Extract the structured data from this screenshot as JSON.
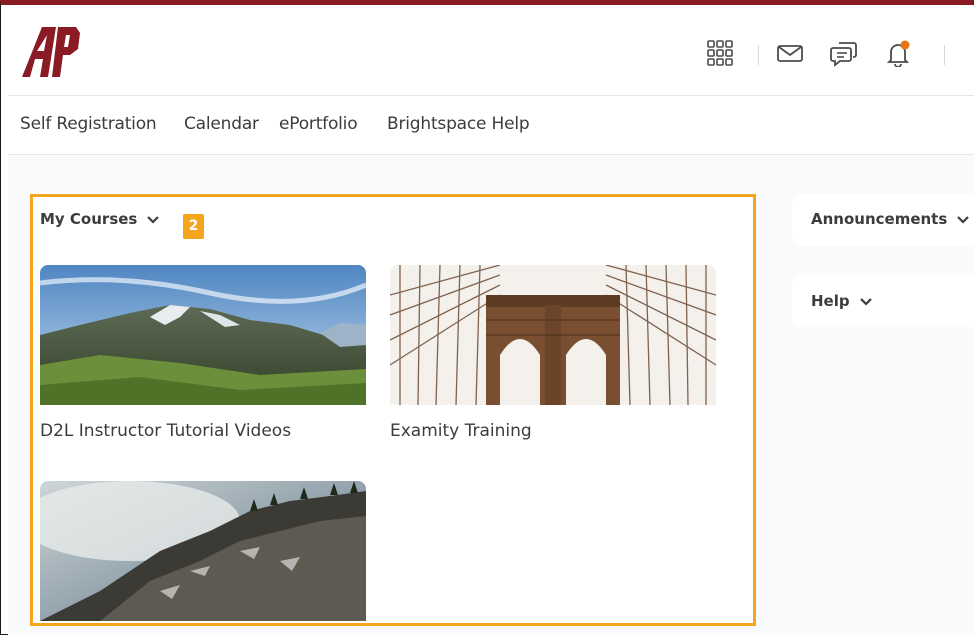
{
  "header": {
    "logo_text": "AP",
    "icons": [
      "waffle-icon",
      "mail-icon",
      "chat-icon",
      "bell-icon"
    ],
    "accent_color": "#8a1a24",
    "notification_color": "#e87511"
  },
  "nav": {
    "links": [
      "Self Registration",
      "Calendar",
      "ePortfolio",
      "Brightspace Help"
    ]
  },
  "my_courses": {
    "title": "My Courses",
    "badge": "2",
    "highlight_color": "#f4a51c",
    "courses": [
      {
        "title": "D2L Instructor Tutorial Videos"
      },
      {
        "title": "Examity Training"
      },
      {
        "title": ""
      }
    ]
  },
  "sidebar": {
    "announcements": "Announcements",
    "help": "Help"
  }
}
